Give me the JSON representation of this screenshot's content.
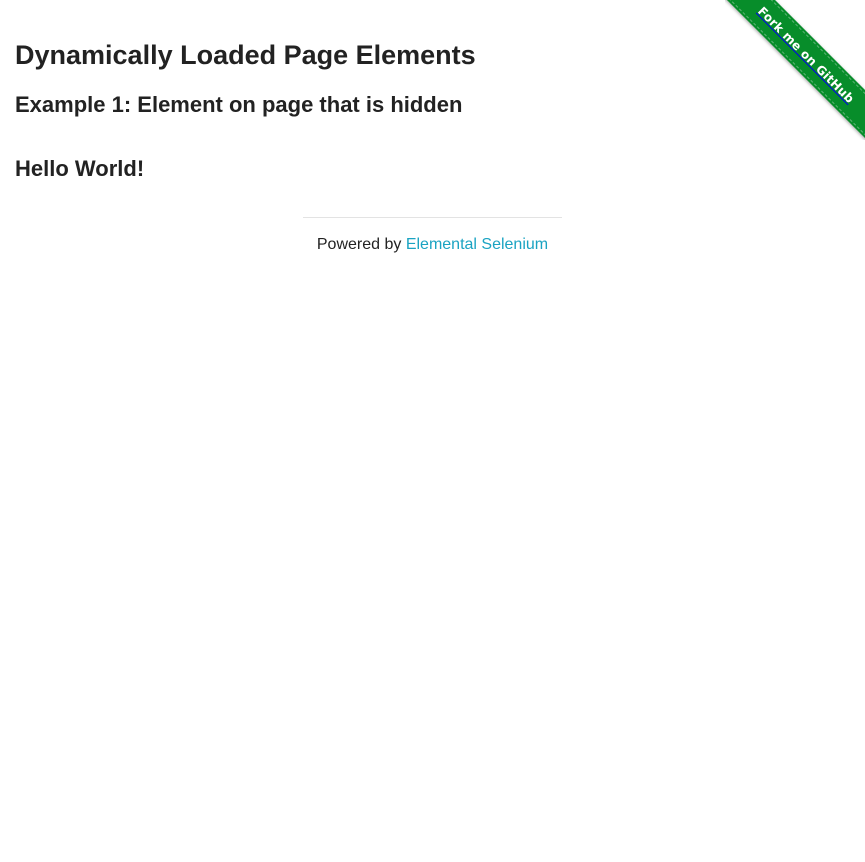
{
  "header": {
    "title": "Dynamically Loaded Page Elements",
    "subtitle": "Example 1: Element on page that is hidden"
  },
  "main": {
    "finish_text": "Hello World!"
  },
  "footer": {
    "powered_by": "Powered by ",
    "link_label": "Elemental Selenium"
  },
  "ribbon": {
    "label": "Fork me on GitHub",
    "color": "#078d2a"
  },
  "colors": {
    "link": "#1aa3c2",
    "text": "#222222"
  }
}
